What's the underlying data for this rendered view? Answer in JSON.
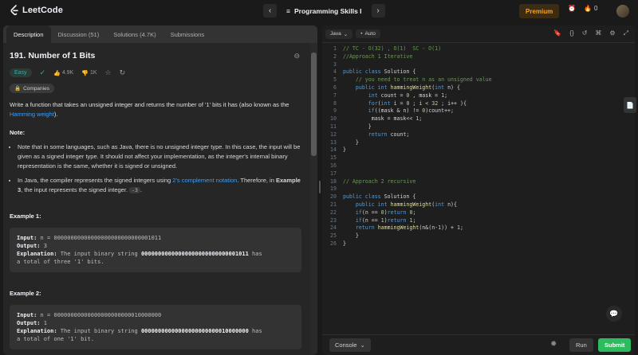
{
  "app": {
    "name": "LeetCode"
  },
  "header": {
    "list_title": "Programming Skills I",
    "premium_label": "Premium",
    "streak_count": "0"
  },
  "left_tabs": [
    {
      "label": "Description"
    },
    {
      "label": "Discussion (51)"
    },
    {
      "label": "Solutions (4.7K)"
    },
    {
      "label": "Submissions"
    }
  ],
  "problem": {
    "title": "191. Number of 1 Bits",
    "difficulty": "Easy",
    "likes": "4.9K",
    "dislikes": "1K",
    "companies_label": "Companies",
    "description_a": "Write a function that takes an unsigned integer and returns the number of '1' bits it has (also known as the ",
    "description_link": "Hamming weight",
    "description_b": ").",
    "note_heading": "Note:",
    "note1": "Note that in some languages, such as Java, there is no unsigned integer type. In this case, the input will be given as a signed integer type. It should not affect your implementation, as the integer's internal binary representation is the same, whether it is signed or unsigned.",
    "note2_a": "In Java, the compiler represents the signed integers using ",
    "note2_link": "2's complement notation",
    "note2_b": ". Therefore, in ",
    "note2_bold": "Example 3",
    "note2_c": ", the input represents the signed integer. ",
    "note2_code": "-3",
    "note2_d": ".",
    "examples": [
      {
        "heading": "Example 1:",
        "input_label": "Input:",
        "input": "n = 00000000000000000000000000001011",
        "output_label": "Output:",
        "output": "3",
        "expl_label": "Explanation:",
        "expl_a": "The input binary string",
        "expl_bold": "00000000000000000000000000001011",
        "expl_b": "has",
        "expl_c": "a total of three '1' bits."
      },
      {
        "heading": "Example 2:",
        "input_label": "Input:",
        "input": "n = 00000000000000000000000010000000",
        "output_label": "Output:",
        "output": "1",
        "expl_label": "Explanation:",
        "expl_a": "The input binary string",
        "expl_bold": "00000000000000000000000010000000",
        "expl_b": "has",
        "expl_c": "a total of one '1' bit."
      }
    ]
  },
  "editor": {
    "language": "Java",
    "mode": "Auto",
    "line_numbers": [
      "1",
      "2",
      "3",
      "4",
      "5",
      "6",
      "7",
      "8",
      "9",
      "10",
      "11",
      "12",
      "13",
      "14",
      "15",
      "16",
      "17",
      "18",
      "19",
      "20",
      "21",
      "22",
      "23",
      "24",
      "25",
      "26"
    ]
  },
  "bottom": {
    "console_label": "Console",
    "run_label": "Run",
    "submit_label": "Submit"
  }
}
